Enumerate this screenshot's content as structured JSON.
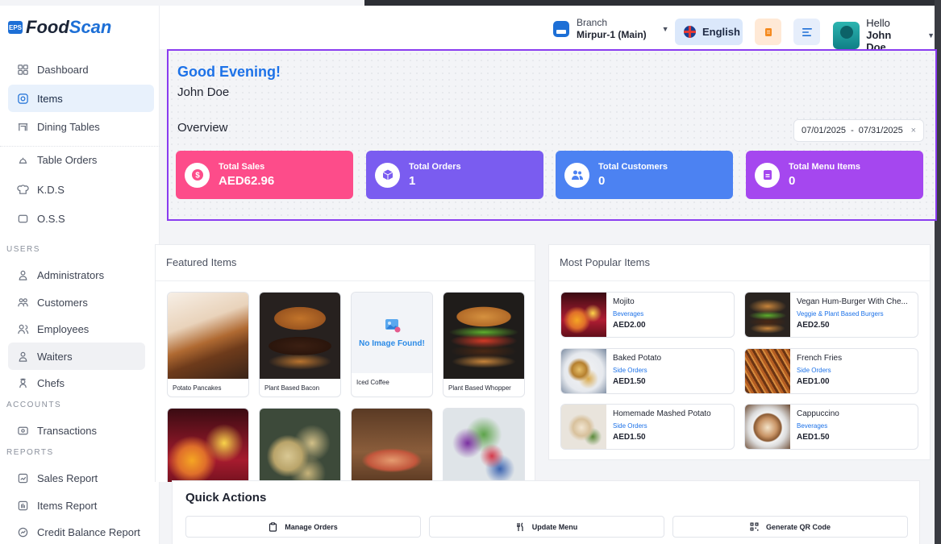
{
  "brand": {
    "mark": "EPS",
    "name_part1": "Food",
    "name_part2": "Scan"
  },
  "sidebar": {
    "items": [
      {
        "label": "Dashboard",
        "icon": "dashboard-icon"
      },
      {
        "label": "Items",
        "icon": "items-icon",
        "active": true
      },
      {
        "label": "Dining Tables",
        "icon": "dining-table-icon"
      },
      {
        "label": "Table Orders",
        "icon": "table-orders-icon"
      },
      {
        "label": "K.D.S",
        "icon": "chef-hat-icon"
      },
      {
        "label": "O.S.S",
        "icon": "monitor-icon"
      },
      {
        "label": "Administrators",
        "icon": "user-icon"
      },
      {
        "label": "Customers",
        "icon": "users-icon"
      },
      {
        "label": "Employees",
        "icon": "employees-icon"
      },
      {
        "label": "Waiters",
        "icon": "waiter-icon"
      },
      {
        "label": "Chefs",
        "icon": "chef-icon"
      },
      {
        "label": "Transactions",
        "icon": "transactions-icon"
      },
      {
        "label": "Sales Report",
        "icon": "sales-report-icon"
      },
      {
        "label": "Items Report",
        "icon": "items-report-icon"
      },
      {
        "label": "Credit Balance Report",
        "icon": "credit-report-icon"
      }
    ],
    "sections": {
      "users": "USERS",
      "accounts": "ACCOUNTS",
      "reports": "REPORTS"
    }
  },
  "header": {
    "branch_label": "Branch",
    "branch_value": "Mirpur-1 (Main)",
    "language": "English",
    "user_greeting": "Hello",
    "user_name": "John Doe"
  },
  "overview": {
    "greeting": "Good Evening!",
    "name": "John Doe",
    "title": "Overview",
    "date_from": "07/01/2025",
    "date_sep": "-",
    "date_to": "07/31/2025",
    "date_clear": "×",
    "stats": [
      {
        "label": "Total Sales",
        "value": "AED62.96",
        "color": "#fd4c8a",
        "icon": "dollar-icon"
      },
      {
        "label": "Total Orders",
        "value": "1",
        "color": "#7a5cf0",
        "icon": "box-icon"
      },
      {
        "label": "Total Customers",
        "value": "0",
        "color": "#4c82f2",
        "icon": "users-icon"
      },
      {
        "label": "Total Menu Items",
        "value": "0",
        "color": "#a547ef",
        "icon": "menu-icon"
      }
    ]
  },
  "featured": {
    "title": "Featured Items",
    "items": [
      {
        "name": "Potato Pancakes"
      },
      {
        "name": "Plant Based Bacon"
      },
      {
        "name": "Iced Coffee",
        "no_image": "No Image Found!"
      },
      {
        "name": "Plant Based Whopper"
      }
    ]
  },
  "popular": {
    "title": "Most Popular Items",
    "items": [
      {
        "name": "Mojito",
        "category": "Beverages",
        "price": "AED2.00"
      },
      {
        "name": "Vegan Hum-Burger With Che...",
        "category": "Veggie & Plant Based Burgers",
        "price": "AED2.50"
      },
      {
        "name": "Baked Potato",
        "category": "Side Orders",
        "price": "AED1.50"
      },
      {
        "name": "French Fries",
        "category": "Side Orders",
        "price": "AED1.00"
      },
      {
        "name": "Homemade Mashed Potato",
        "category": "Side Orders",
        "price": "AED1.50"
      },
      {
        "name": "Cappuccino",
        "category": "Beverages",
        "price": "AED1.50"
      }
    ]
  },
  "quick_actions": {
    "title": "Quick Actions",
    "buttons": [
      {
        "label": "Manage Orders",
        "icon": "clipboard-icon"
      },
      {
        "label": "Update Menu",
        "icon": "utensils-icon"
      },
      {
        "label": "Generate QR Code",
        "icon": "qr-code-icon"
      }
    ]
  },
  "colors": {
    "accent": "#1d72e8",
    "highlight_border": "#8a3cf0"
  }
}
